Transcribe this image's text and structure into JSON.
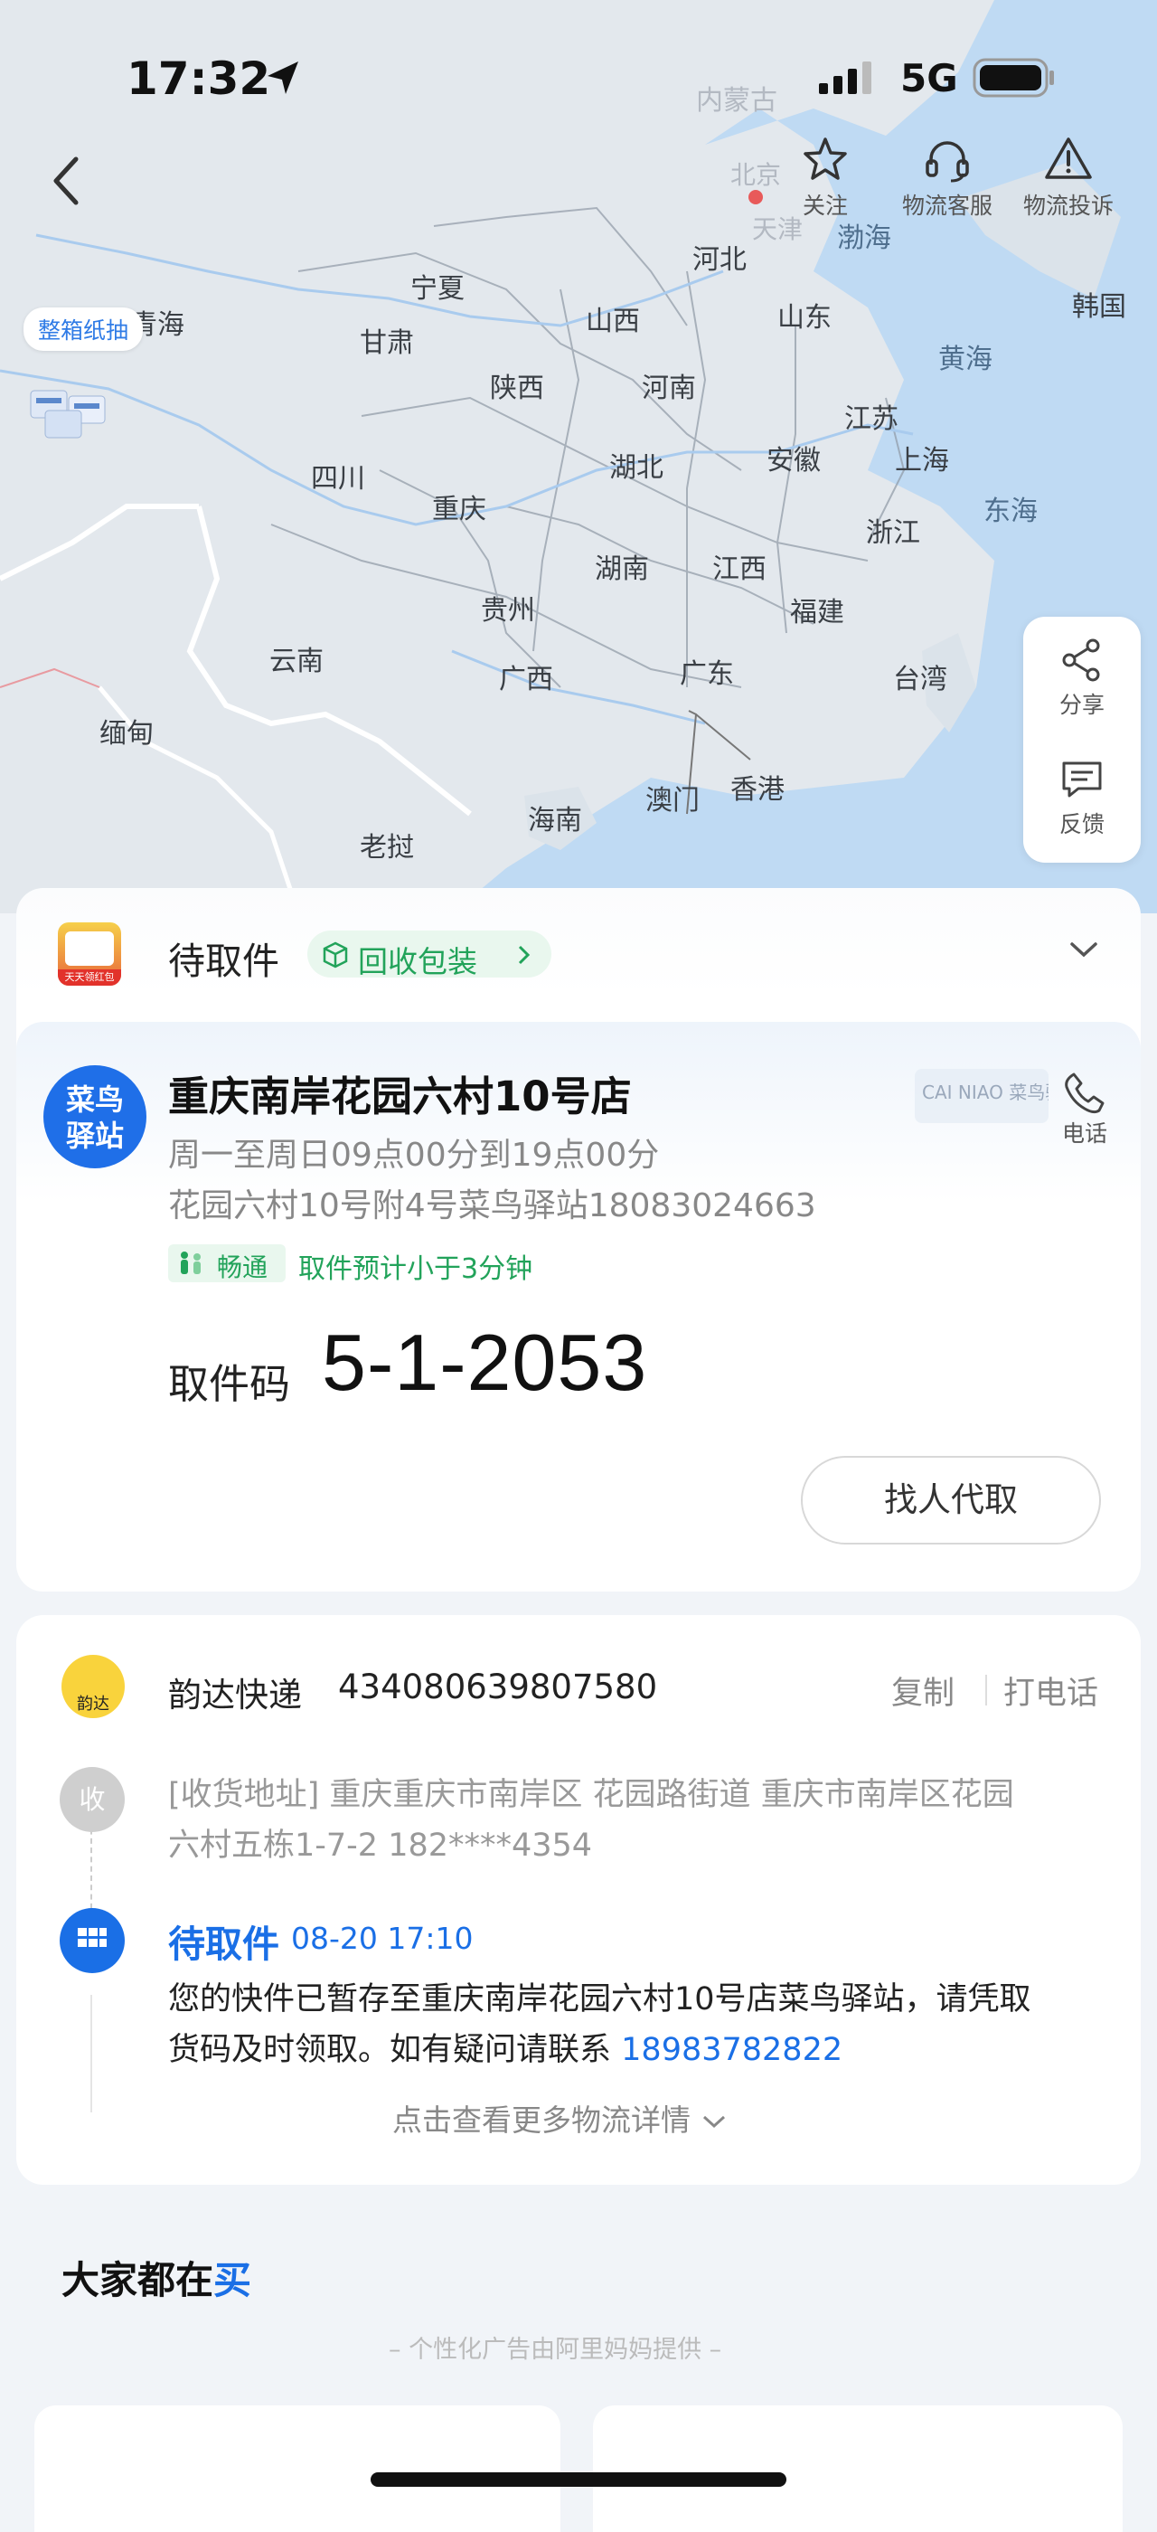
{
  "status_bar": {
    "time": "17:32",
    "network": "5G"
  },
  "top_actions": {
    "follow": "关注",
    "service": "物流客服",
    "complaint": "物流投诉"
  },
  "map": {
    "promo_tag": "整箱纸抽",
    "labels": {
      "neimenggu": "内蒙古",
      "beijing": "北京",
      "tianjin": "天津",
      "bohai": "渤海",
      "hebei": "河北",
      "ningxia": "宁夏",
      "qinghai": "青海",
      "gansu": "甘肃",
      "shanxi": "山西",
      "shandong": "山东",
      "korea": "韩国",
      "shaanxi": "陕西",
      "henan": "河南",
      "huanghai": "黄海",
      "sichuan": "四川",
      "jiangsu": "江苏",
      "anhui": "安徽",
      "hubei": "湖北",
      "shanghai": "上海",
      "chongqing": "重庆",
      "zhejiang": "浙江",
      "donghai": "东海",
      "hunan": "湖南",
      "jiangxi": "江西",
      "guizhou": "贵州",
      "fujian": "福建",
      "yunnan": "云南",
      "guangxi": "广西",
      "guangdong": "广东",
      "taiwan": "台湾",
      "myanmar": "缅甸",
      "macau": "澳门",
      "hongkong": "香港",
      "hainan": "海南",
      "laos": "老挝"
    }
  },
  "side_tools": {
    "share": "分享",
    "feedback": "反馈"
  },
  "pickup": {
    "status": "待取件",
    "recycle": "回收包装",
    "thumb_brand": "天天领红包",
    "station_badge": "菜鸟驿站",
    "station_name": "重庆南岸花园六村10号店",
    "hours": "周一至周日09点00分到19点00分",
    "address_phone": "花园六村10号附4号菜鸟驿站18083024663",
    "traffic_badge": "畅通",
    "eta": "取件预计小于3分钟",
    "code_label": "取件码",
    "code": "5-1-2053",
    "call_label": "电话",
    "proxy_button": "找人代取",
    "cainiao_watermark": "CAI NIAO 菜鸟驿站"
  },
  "logistics": {
    "courier_icon_text": "韵达",
    "courier_name": "韵达快递",
    "tracking_no": "434080639807580",
    "copy": "复制",
    "call": "打电话",
    "receive_marker": "收",
    "receive_address_line1": "[收货地址] 重庆重庆市南岸区  花园路街道   重庆市南岸区花园",
    "receive_address_line2": "六村五栋1-7-2 182****4354",
    "event_status": "待取件",
    "event_time": "08-20 17:10",
    "event_desc_line1": "您的快件已暂存至重庆南岸花园六村10号店菜鸟驿站，请凭取",
    "event_desc_line2": "货码及时领取。如有疑问请联系",
    "contact_phone": "18983782822",
    "more": "点击查看更多物流详情"
  },
  "recommend": {
    "title": "大家都在",
    "title_tail": "买",
    "ad_note": "– 个性化广告由阿里妈妈提供 –"
  },
  "colors": {
    "accent_blue": "#1a6fe6",
    "green": "#22a35a"
  }
}
